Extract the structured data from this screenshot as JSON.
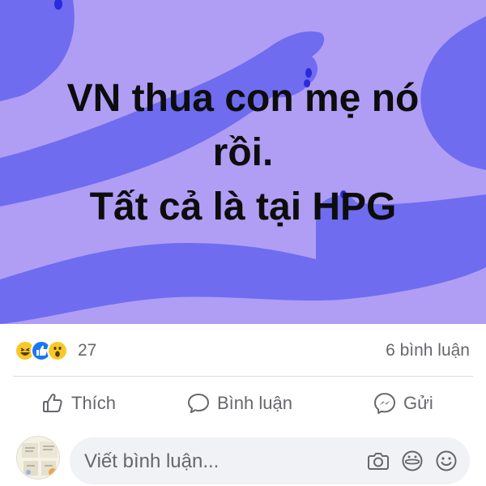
{
  "post": {
    "background_color": "#b09ef5",
    "shape_color": "#6f6cf0",
    "text_lines": [
      "VN thua con mẹ nó",
      "rồi.",
      "Tất cả là tại HPG"
    ]
  },
  "reactions": {
    "icons": [
      "haha-icon",
      "like-icon",
      "wow-icon"
    ],
    "count": "27",
    "comments_label": "6 bình luận"
  },
  "actions": {
    "like_label": "Thích",
    "comment_label": "Bình luận",
    "share_label": "Gửi"
  },
  "comment_composer": {
    "placeholder": "Viết bình luận...",
    "icons": [
      "camera-icon",
      "gif-icon",
      "emoji-icon"
    ]
  },
  "colors": {
    "muted_text": "#65676b",
    "like_blue": "#1877f2",
    "reaction_yellow": "#f7c928"
  }
}
